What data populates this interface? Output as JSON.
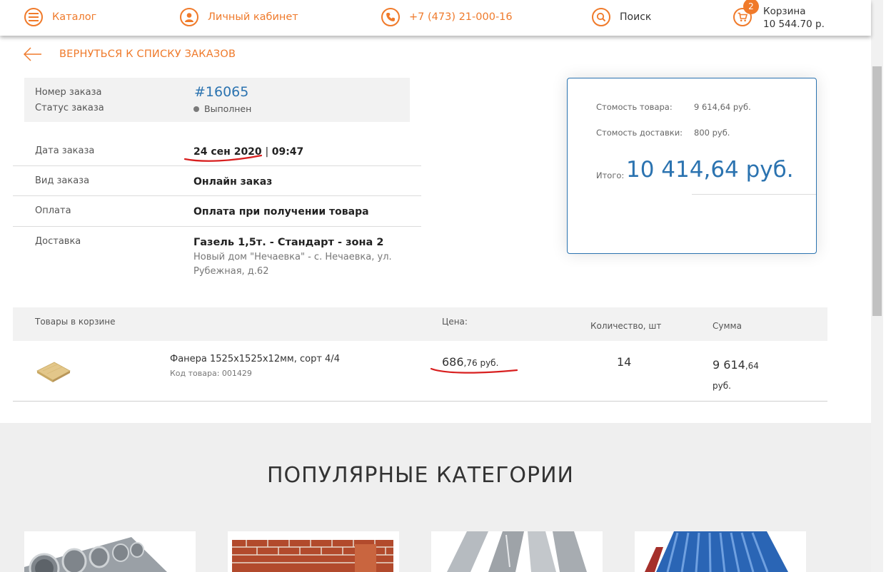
{
  "header": {
    "catalog": "Каталог",
    "account": "Личный кабинет",
    "phone": "+7 (473) 21-000-16",
    "search": "Поиск",
    "cart_count": "2",
    "cart_label": "Корзина",
    "cart_total": "10 544.70 р."
  },
  "back_link": "ВЕРНУТЬСЯ К СПИСКУ ЗАКАЗОВ",
  "order": {
    "number_label": "Номер заказа",
    "number": "#16065",
    "status_label": "Статус заказа",
    "status": "Выполнен",
    "date_label": "Дата заказа",
    "date": "24 сен 2020",
    "time": "09:47",
    "type_label": "Вид заказа",
    "type": "Онлайн заказ",
    "payment_label": "Оплата",
    "payment": "Оплата при получении товара",
    "delivery_label": "Доставка",
    "delivery": "Газель 1,5т. - Стандарт - зона 2",
    "address_line1": "Новый дом \"Нечаевка\" - с. Нечаевка, ул.",
    "address_line2": "Рубежная, д.62"
  },
  "summary": {
    "goods_label": "Стомость товара:",
    "goods_value": "9 614,64 руб.",
    "delivery_label": "Стомость доставки:",
    "delivery_value": "800 руб.",
    "total_label": "Итого:",
    "total_value": "10 414,64 руб."
  },
  "table": {
    "headers": [
      "Товары в корзине",
      "Цена:",
      "Количество, шт",
      "Сумма"
    ],
    "rows": [
      {
        "name": "Фанера 1525х1525х12мм, сорт 4/4",
        "code": "Код товара: 001429",
        "price_int": "686",
        "price_frac": ",76 руб.",
        "qty": "14",
        "sum_int": "9 614",
        "sum_frac": ",64",
        "sum_unit": "руб."
      }
    ]
  },
  "popular_title": "ПОПУЛЯРНЫЕ КАТЕГОРИИ",
  "colors": {
    "accent_orange": "#ef7a2b",
    "accent_blue": "#2b73b0",
    "annotation_red": "#d81f1f"
  }
}
